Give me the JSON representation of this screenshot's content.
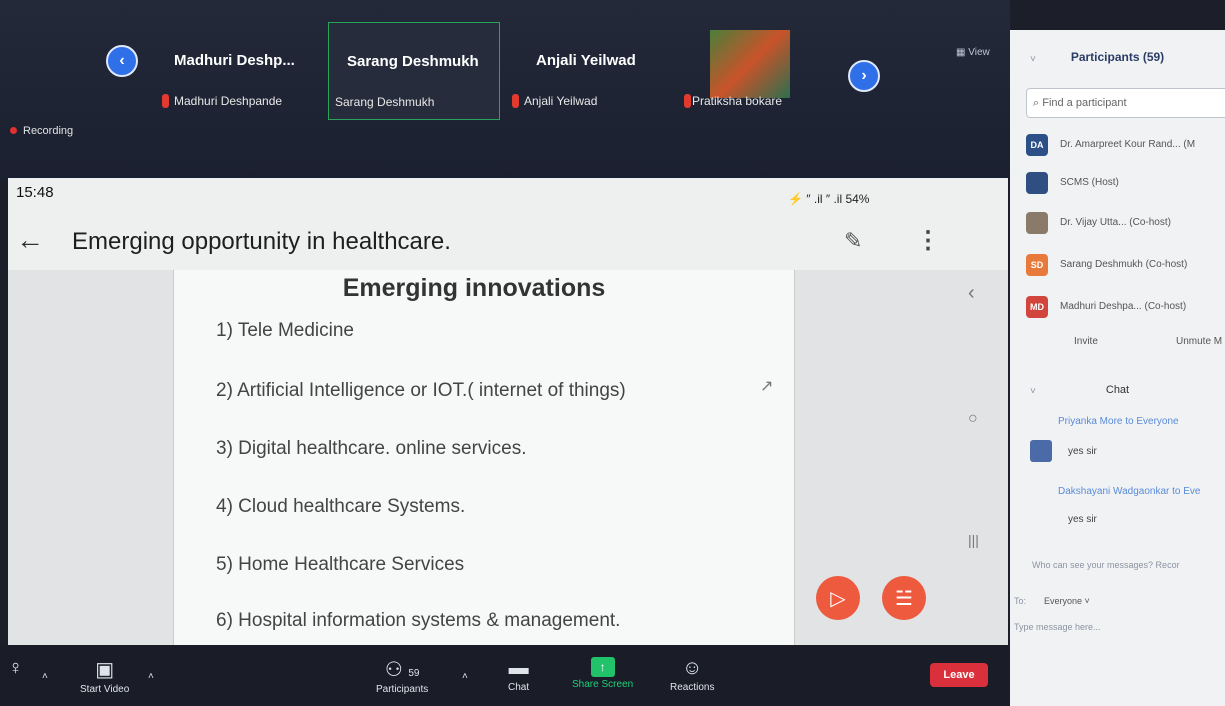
{
  "meeting": {
    "recording_label": "Recording",
    "view_label": "View",
    "participants_strip": [
      {
        "display_name": "Madhuri  Deshp...",
        "full_name": "Madhuri Deshpande"
      },
      {
        "display_name": "Sarang Deshmukh",
        "full_name": "Sarang Deshmukh"
      },
      {
        "display_name": "Anjali Yeilwad",
        "full_name": "Anjali Yeilwad"
      },
      {
        "display_name": "",
        "full_name": "Pratiksha bokare"
      }
    ]
  },
  "shared_screen": {
    "time": "15:48",
    "status_icons": "⚡ ″ .il ″ .il 54%",
    "app_title": "Emerging opportunity in healthcare.",
    "slide": {
      "title": "Emerging innovations",
      "items": [
        "1) Tele Medicine",
        "2) Artificial Intelligence or IOT.( internet of things)",
        "3) Digital healthcare. online services.",
        "4) Cloud healthcare Systems.",
        "5) Home Healthcare Services",
        "6) Hospital information systems & management."
      ]
    }
  },
  "toolbar": {
    "start_video": "Start Video",
    "participants_count": "59",
    "participants": "Participants",
    "chat": "Chat",
    "share_screen": "Share Screen",
    "reactions": "Reactions",
    "leave": "Leave"
  },
  "sidebar": {
    "header": "Participants (59)",
    "search_placeholder": "Find a participant",
    "participants": [
      {
        "initials": "DA",
        "name": "Dr. Amarpreet Kour Rand... (M",
        "color": "#2b4f86"
      },
      {
        "initials": "",
        "name": "SCMS (Host)",
        "color": "#2f4f82"
      },
      {
        "initials": "",
        "name": "Dr. Vijay Utta... (Co-host)",
        "color": "#8a7a6a"
      },
      {
        "initials": "SD",
        "name": "Sarang Deshmukh (Co-host)",
        "color": "#e77a3a"
      },
      {
        "initials": "MD",
        "name": "Madhuri Deshpa... (Co-host)",
        "color": "#d2453c"
      }
    ],
    "invite": "Invite",
    "unmute": "Unmute M",
    "chat_header": "Chat",
    "messages": [
      {
        "from": "Priyanka More to Everyone",
        "text": "yes sir"
      },
      {
        "from": "Dakshayani Wadgaonkar to Eve",
        "text": "yes sir"
      }
    ],
    "who_can_see": "Who can see your messages? Recor",
    "to_label": "To:",
    "to_value": "Everyone",
    "message_placeholder": "Type message here..."
  }
}
